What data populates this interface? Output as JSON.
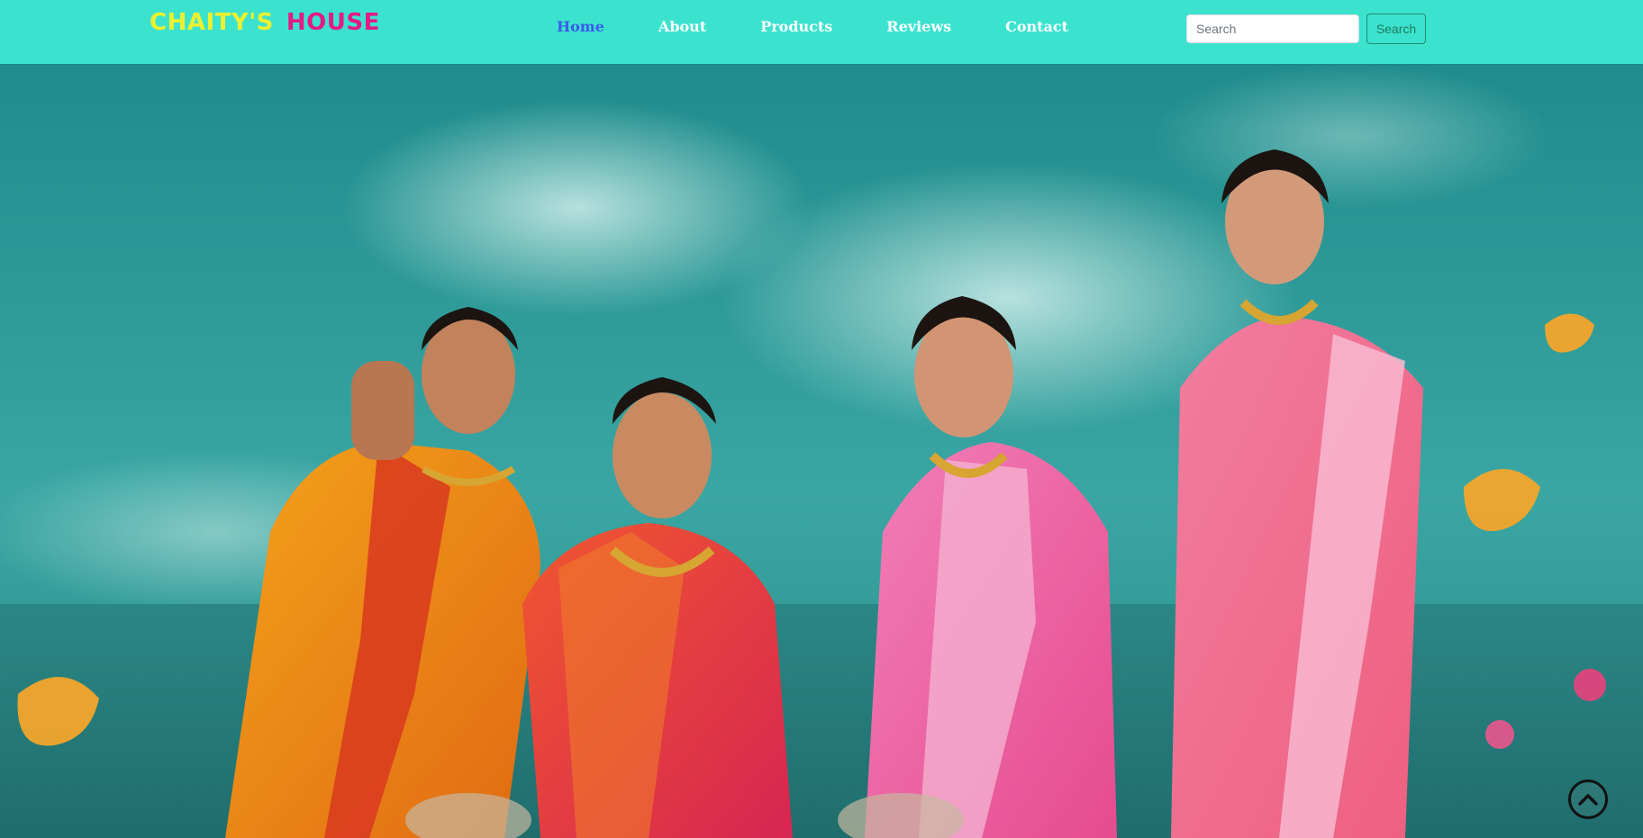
{
  "brand": {
    "part1": "CHAITY'S",
    "part2": "HOUSE"
  },
  "nav": {
    "items": [
      {
        "label": "Home",
        "active": true
      },
      {
        "label": "About"
      },
      {
        "label": "Products"
      },
      {
        "label": "Reviews"
      },
      {
        "label": "Contact"
      }
    ]
  },
  "search": {
    "placeholder": "Search",
    "button_label": "Search"
  },
  "hero": {
    "image": "hero-banner-four-women-in-silk-sarees"
  },
  "scroll_top": {
    "icon": "chevron-up-icon"
  },
  "colors": {
    "navbar_bg": "#3be3cf",
    "brand_part1": "#ecf02f",
    "brand_part2": "#e51a83",
    "nav_active": "#3a5bea",
    "nav_text": "#ffffff"
  }
}
